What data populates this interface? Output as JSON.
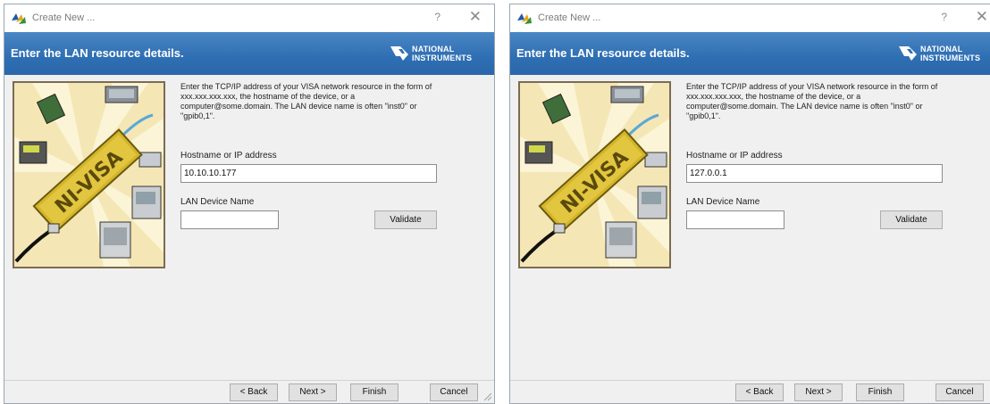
{
  "windows": [
    {
      "title": "Create New ...",
      "help_glyph": "?",
      "close_glyph": "✕",
      "banner_title": "Enter the LAN resource details.",
      "logo_line1": "NATIONAL",
      "logo_line2": "INSTRUMENTS",
      "description": "Enter the TCP/IP address of your VISA network resource in the form of xxx.xxx.xxx.xxx, the hostname of the device, or a computer@some.domain. The LAN device name is often \"inst0\" or \"gpib0,1\".",
      "hostname_label": "Hostname or IP address",
      "hostname_value": "10.10.10.177",
      "lan_label": "LAN Device Name",
      "lan_value": "",
      "validate_label": "Validate",
      "buttons": {
        "back": "< Back",
        "next": "Next >",
        "finish": "Finish",
        "cancel": "Cancel"
      }
    },
    {
      "title": "Create New ...",
      "help_glyph": "?",
      "close_glyph": "✕",
      "banner_title": "Enter the LAN resource details.",
      "logo_line1": "NATIONAL",
      "logo_line2": "INSTRUMENTS",
      "description": "Enter the TCP/IP address of your VISA network resource in the form of xxx.xxx.xxx.xxx, the hostname of the device, or a computer@some.domain. The LAN device name is often \"inst0\" or \"gpib0,1\".",
      "hostname_label": "Hostname or IP address",
      "hostname_value": "127.0.0.1",
      "lan_label": "LAN Device Name",
      "lan_value": "",
      "validate_label": "Validate",
      "buttons": {
        "back": "< Back",
        "next": "Next >",
        "finish": "Finish",
        "cancel": "Cancel"
      }
    }
  ],
  "art_text": "NI-VISA",
  "colors": {
    "banner": "#2e6eb2",
    "window_bg": "#f0f0f0",
    "art_bg": "#f4e7b5",
    "visa_gold": "#d4b52a"
  },
  "icons": [
    "app-logo-icon",
    "help-icon",
    "close-icon",
    "ni-eagle-icon",
    "resize-grip-icon"
  ]
}
